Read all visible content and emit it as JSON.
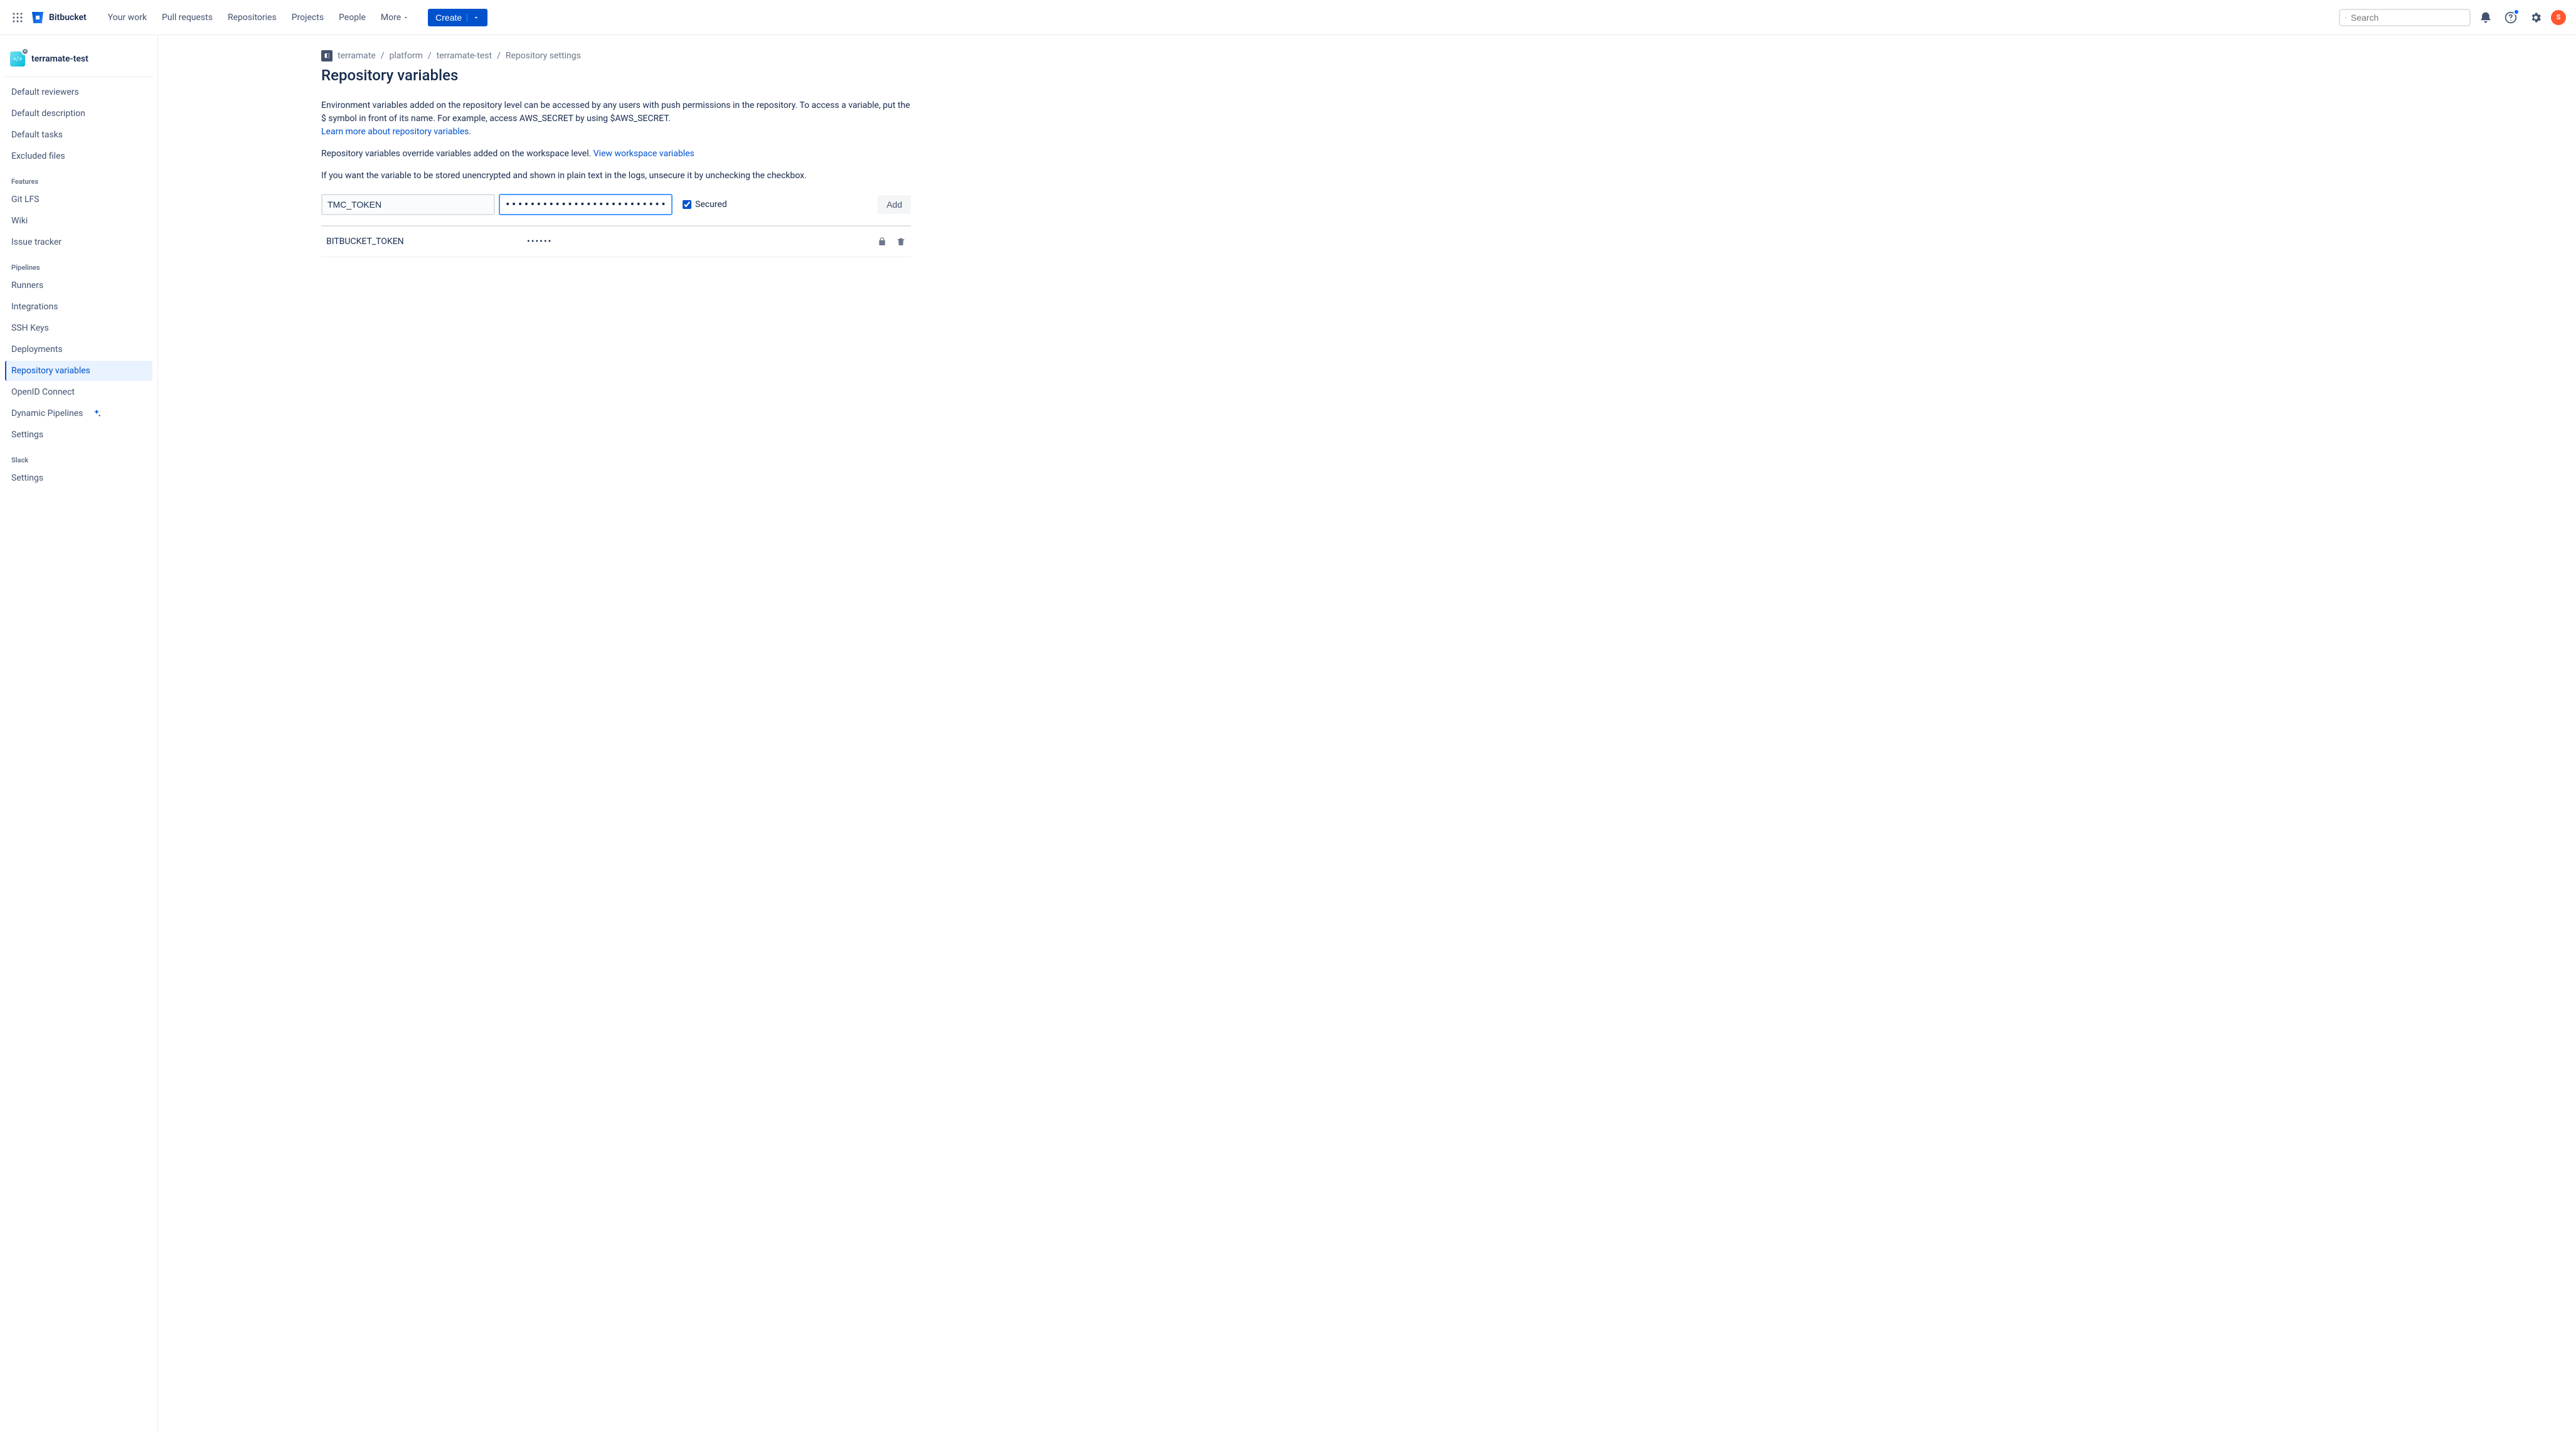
{
  "topnav": {
    "brand": "Bitbucket",
    "links": [
      "Your work",
      "Pull requests",
      "Repositories",
      "Projects",
      "People",
      "More"
    ],
    "create_label": "Create",
    "search_placeholder": "Search",
    "avatar_initial": "S"
  },
  "sidebar": {
    "repo_name": "terramate-test",
    "items_top": [
      "Default reviewers",
      "Default description",
      "Default tasks",
      "Excluded files"
    ],
    "features_label": "Features",
    "items_features": [
      "Git LFS",
      "Wiki",
      "Issue tracker"
    ],
    "pipelines_label": "Pipelines",
    "items_pipelines": [
      "Runners",
      "Integrations",
      "SSH Keys",
      "Deployments",
      "Repository variables",
      "OpenID Connect",
      "Dynamic Pipelines",
      "Settings"
    ],
    "slack_label": "Slack",
    "items_slack": [
      "Settings"
    ]
  },
  "breadcrumbs": {
    "items": [
      "terramate",
      "platform",
      "terramate-test",
      "Repository settings"
    ]
  },
  "page": {
    "title": "Repository variables",
    "desc1": "Environment variables added on the repository level can be accessed by any users with push permissions in the repository. To access a variable, put the $ symbol in front of its name. For example, access AWS_SECRET by using $AWS_SECRET.",
    "learn_more": "Learn more about repository variables",
    "desc2_a": "Repository variables override variables added on the workspace level. ",
    "desc2_link": "View workspace variables",
    "desc3": "If you want the variable to be stored unencrypted and shown in plain text in the logs, unsecure it by unchecking the checkbox."
  },
  "form": {
    "name_value": "TMC_TOKEN",
    "value_mask": "••••••••••••••••••••••••••••••••••••••••••••",
    "secured_label": "Secured",
    "add_label": "Add"
  },
  "vars": [
    {
      "name": "BITBUCKET_TOKEN",
      "value": "••••••"
    }
  ]
}
